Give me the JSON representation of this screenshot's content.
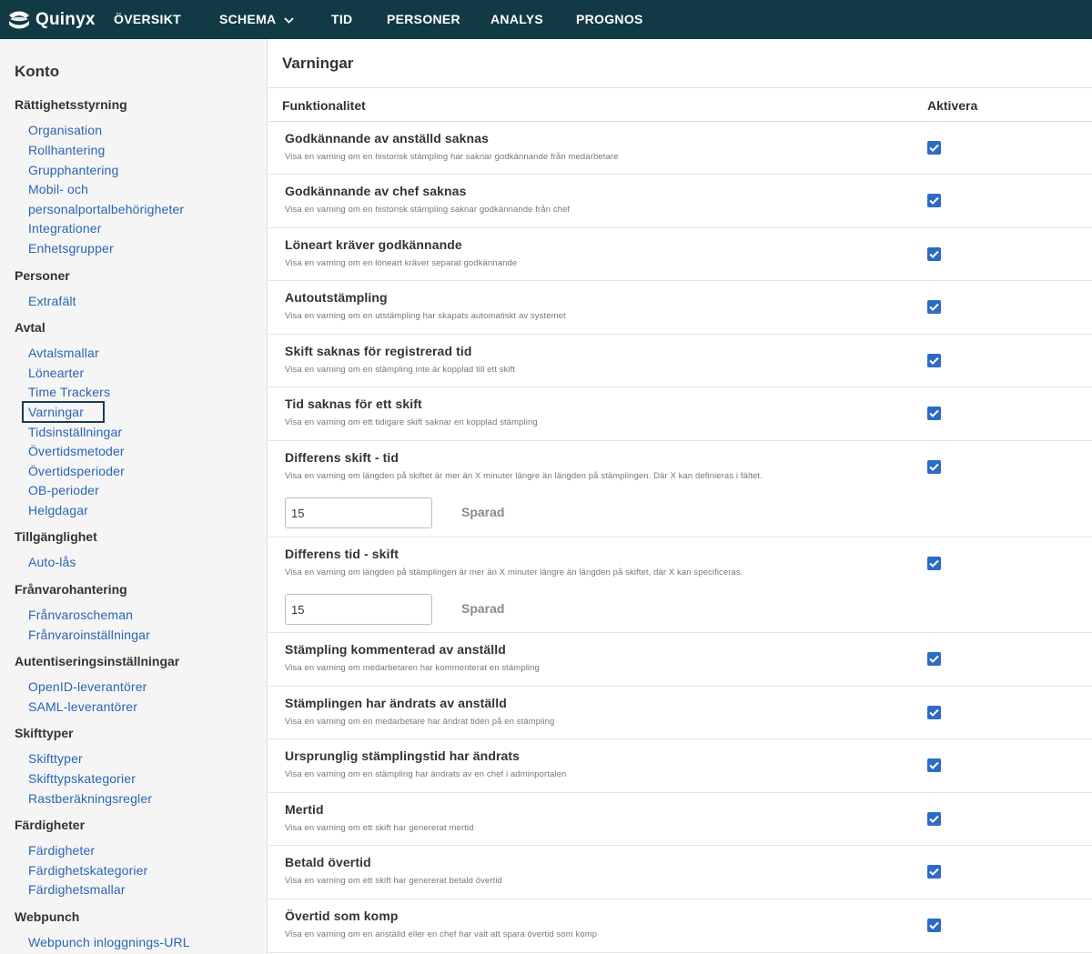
{
  "brand": {
    "name": "Quinyx"
  },
  "nav": [
    {
      "label": "ÖVERSIKT"
    },
    {
      "label": "SCHEMA",
      "has_dropdown": true
    },
    {
      "label": "TID"
    },
    {
      "label": "PERSONER"
    },
    {
      "label": "ANALYS"
    },
    {
      "label": "PROGNOS"
    }
  ],
  "sidebar": {
    "title": "Konto",
    "sections": [
      {
        "label": "Rättighetsstyrning",
        "items": [
          "Organisation",
          "Rollhantering",
          "Grupphantering",
          "Mobil- och",
          "personalportalbehörigheter",
          "Integrationer",
          "Enhetsgrupper"
        ]
      },
      {
        "label": "Personer",
        "items": [
          "Extrafält"
        ]
      },
      {
        "label": "Avtal",
        "items": [
          "Avtalsmallar",
          "Lönearter",
          "Time Trackers",
          "Varningar",
          "Tidsinställningar",
          "Övertidsmetoder",
          "Övertidsperioder",
          "OB-perioder",
          "Helgdagar"
        ]
      },
      {
        "label": "Tillgänglighet",
        "items": [
          "Auto-lås"
        ]
      },
      {
        "label": "Frånvarohantering",
        "items": [
          "Frånvaroscheman",
          "Frånvaroinställningar"
        ]
      },
      {
        "label": "Autentiseringsinställningar",
        "items": [
          "OpenID-leverantörer",
          "SAML-leverantörer"
        ]
      },
      {
        "label": "Skifttyper",
        "items": [
          "Skifttyper",
          "Skifttypskategorier",
          "Rastberäkningsregler"
        ]
      },
      {
        "label": "Färdigheter",
        "items": [
          "Färdigheter",
          "Färdighetskategorier",
          "Färdighetsmallar"
        ]
      },
      {
        "label": "Webpunch",
        "items": [
          "Webpunch inloggnings-URL"
        ]
      }
    ],
    "active_item": "Varningar"
  },
  "main": {
    "title": "Varningar",
    "columns": {
      "feature": "Funktionalitet",
      "activate": "Aktivera"
    },
    "rows": [
      {
        "title": "Godkännande av anställd saknas",
        "description": "Visa en varning om en historisk stämpling har saknar godkännande från medarbetare",
        "checked": true
      },
      {
        "title": "Godkännande av chef saknas",
        "description": "Visa en varning om en historisk stämpling saknar godkännande från chef",
        "checked": true
      },
      {
        "title": "Löneart kräver godkännande",
        "description": "Visa en varning om en löneart kräver separat godkännande",
        "checked": true
      },
      {
        "title": "Autoutstämpling",
        "description": "Visa en varning om en utstämpling har skapats automatiskt av systemet",
        "checked": true
      },
      {
        "title": "Skift saknas för registrerad tid",
        "description": "Visa en varning om en stämpling inte är kopplad till ett skift",
        "checked": true
      },
      {
        "title": "Tid saknas för ett skift",
        "description": "Visa en varning om ett tidigare skift saknar en kopplad stämpling",
        "checked": true
      },
      {
        "title": "Differens skift - tid",
        "description": "Visa en varning om längden på skiftet är mer än X minuter längre än längden på stämplingen. Där X kan definieras i fältet.",
        "checked": true,
        "input_value": "15",
        "status": "Sparad"
      },
      {
        "title": "Differens tid - skift",
        "description": "Visa en varning om längden på stämplingen är mer än X minuter längre än längden på skiftet, där X kan specificeras.",
        "checked": true,
        "input_value": "15",
        "status": "Sparad"
      },
      {
        "title": "Stämpling kommenterad av anställd",
        "description": "Visa en varning om medarbetaren har kommenterat en stämpling",
        "checked": true
      },
      {
        "title": "Stämplingen har ändrats av anställd",
        "description": "Visa en varning om en medarbetare har ändrat tiden på en stämpling",
        "checked": true
      },
      {
        "title": "Ursprunglig stämplingstid har ändrats",
        "description": "Visa en varning om en stämpling har ändrats av en chef i adminportalen",
        "checked": true
      },
      {
        "title": "Mertid",
        "description": "Visa en varning om ett skift har genererat mertid",
        "checked": true
      },
      {
        "title": "Betald övertid",
        "description": "Visa en varning om ett skift har genererat betald övertid",
        "checked": true
      },
      {
        "title": "Övertid som komp",
        "description": "Visa en varning om en anställd eller en chef har valt att spara övertid som komp",
        "checked": true
      }
    ]
  },
  "colors": {
    "topbar": "#123a44",
    "link": "#2a64b3",
    "checkbox": "#2e6bc6",
    "sidebar_bg": "#f5f5f5"
  },
  "icons": {
    "logo": "quinyx-logo-icon",
    "dropdown": "chevron-down-icon",
    "check": "check-icon"
  }
}
